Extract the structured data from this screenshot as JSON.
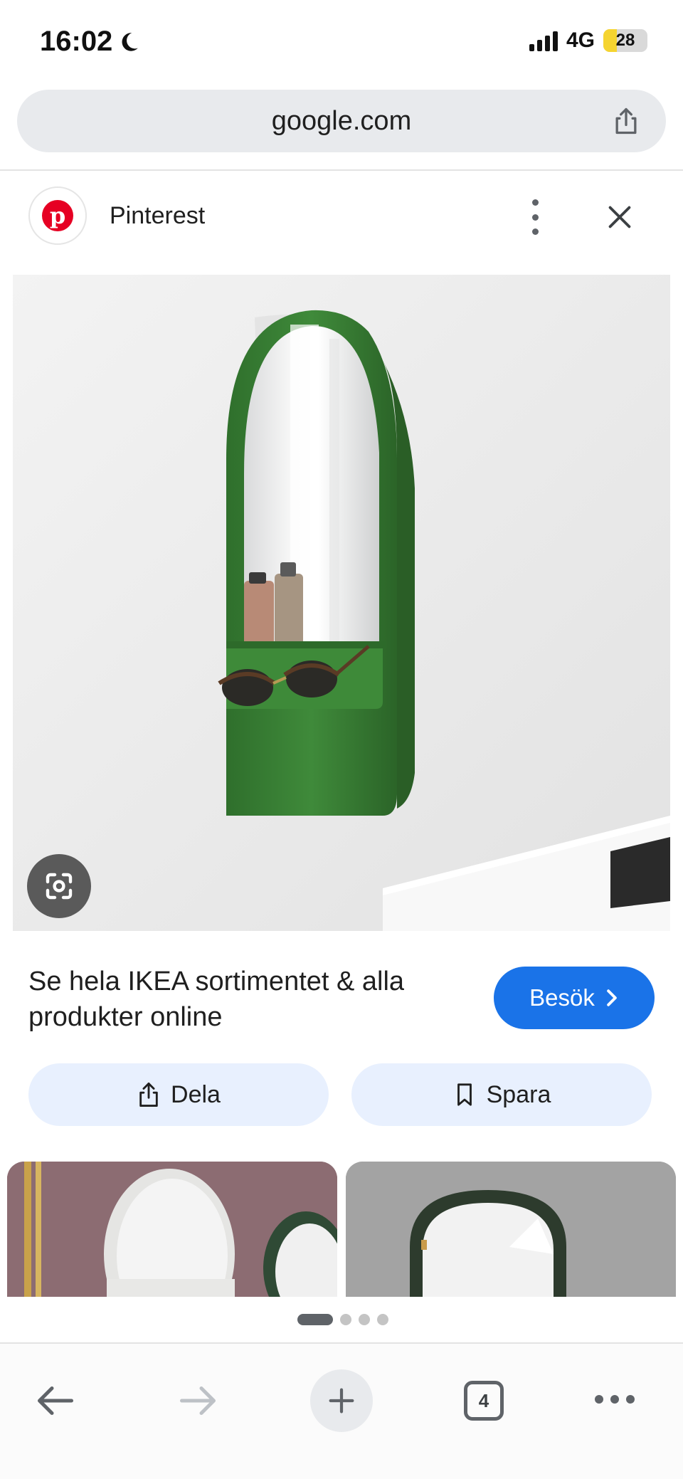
{
  "status_bar": {
    "time": "16:02",
    "network": "4G",
    "battery": "28"
  },
  "browser": {
    "url": "google.com",
    "tab_count": "4"
  },
  "source": {
    "name": "Pinterest"
  },
  "result": {
    "caption": "Se hela IKEA sortimentet & alla produkter online",
    "visit_label": "Besök",
    "share_label": "Dela",
    "save_label": "Spara"
  },
  "pager": {
    "page_count": 4,
    "active_index": 0
  },
  "colors": {
    "accent": "#1a73e8",
    "pinterest_red": "#e60023",
    "mirror_frame_green": "#3f8a3a",
    "button_tint": "#e8f0fe"
  },
  "icons": {
    "moon": "moon-icon",
    "share": "share-icon",
    "more": "more-vert-icon",
    "close": "close-icon",
    "lens": "google-lens-icon",
    "chevron": "chevron-right-icon",
    "bookmark": "bookmark-icon",
    "back": "back-arrow-icon",
    "forward": "forward-arrow-icon",
    "new_tab": "plus-icon",
    "menu": "more-horiz-icon"
  }
}
